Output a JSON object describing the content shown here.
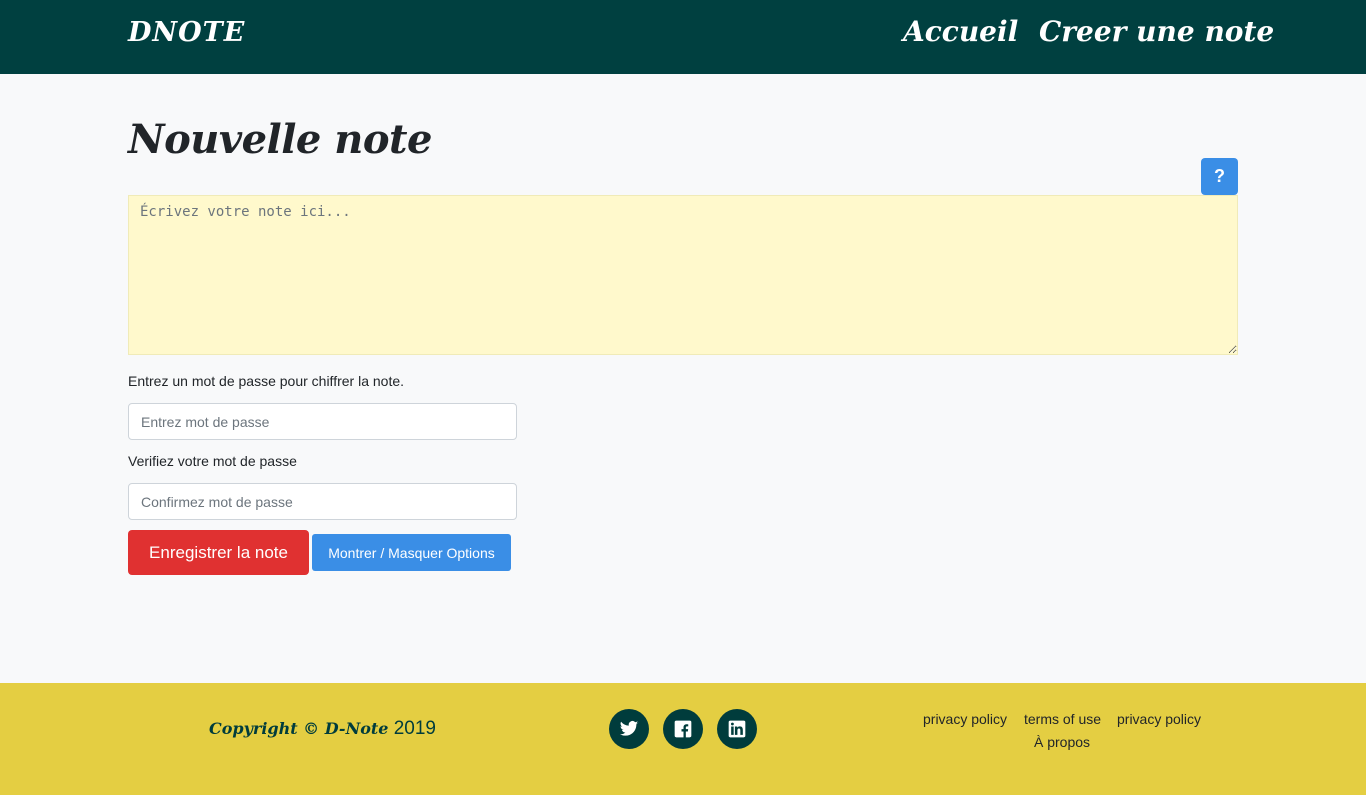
{
  "navbar": {
    "brand": "DNOTE",
    "links": [
      "Accueil",
      "Creer une note"
    ]
  },
  "main": {
    "title": "Nouvelle note",
    "help_label": "?",
    "note_placeholder": "Écrivez votre note ici...",
    "password_label": "Entrez un mot de passe pour chiffrer la note.",
    "password_placeholder": "Entrez mot de passe",
    "verify_label": "Verifiez votre mot de passe",
    "confirm_placeholder": "Confirmez mot de passe",
    "save_label": "Enregistrer la note",
    "options_label": "Montrer / Masquer Options"
  },
  "footer": {
    "copyright_script": "Copyright © D-Note",
    "copyright_year": "2019",
    "social": [
      "twitter-icon",
      "facebook-icon",
      "linkedin-icon"
    ],
    "links": [
      "privacy policy",
      "terms of use",
      "privacy policy",
      "À propos"
    ]
  },
  "colors": {
    "navbar": "#004040",
    "footer": "#e4ce42",
    "note_bg": "#fff9cc",
    "primary": "#3a8ee6",
    "danger": "#e03131"
  }
}
